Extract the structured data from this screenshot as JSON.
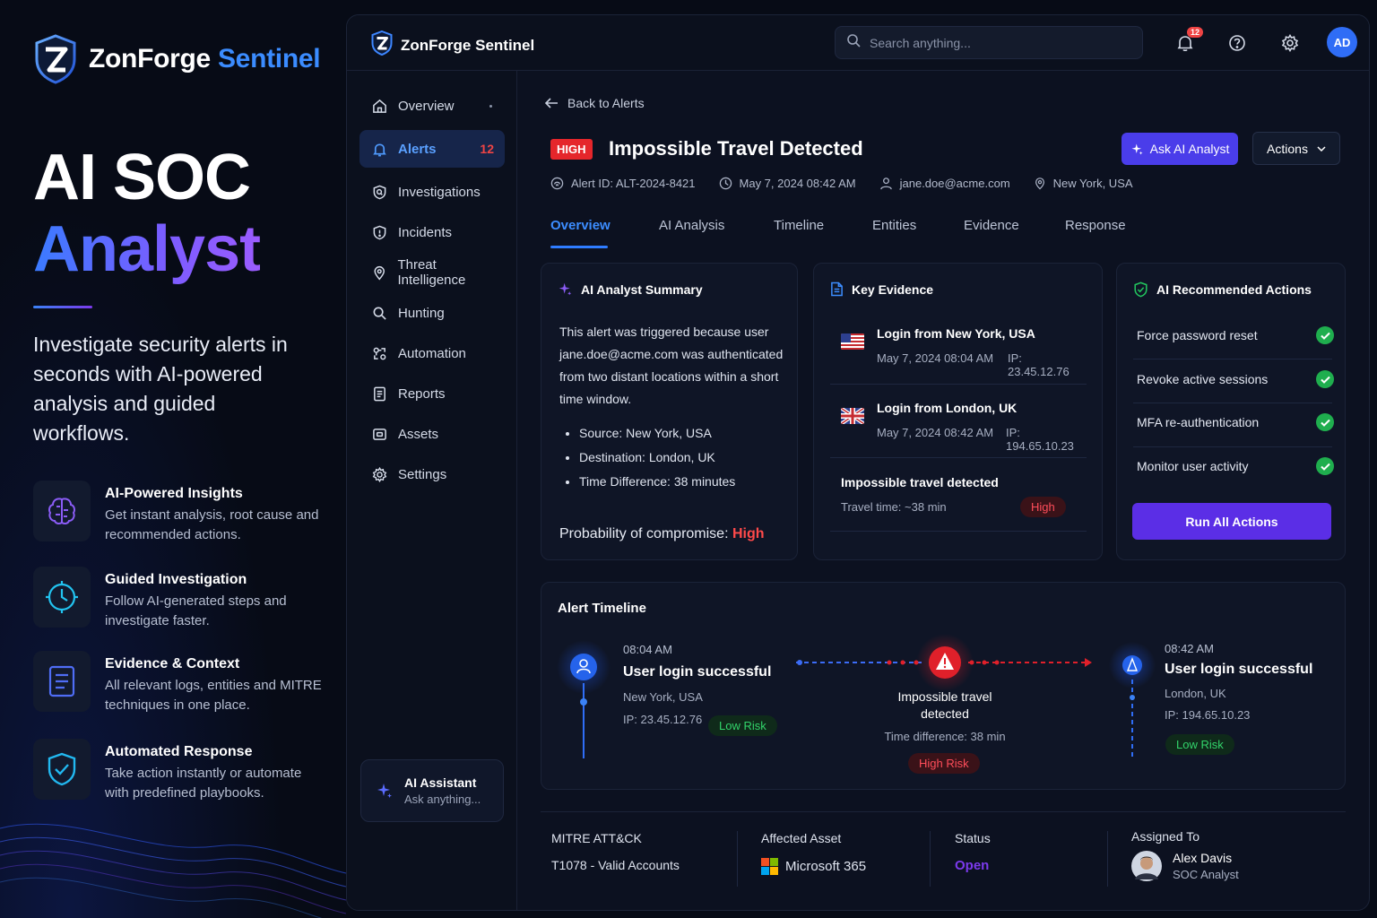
{
  "promo": {
    "brand_word1": "ZonForge",
    "brand_word2": "Sentinel",
    "headline_line1": "AI SOC",
    "headline_line2": "Analyst",
    "tagline": "Investigate security alerts in seconds with AI-powered analysis and guided workflows.",
    "features": [
      {
        "title": "AI-Powered Insights",
        "desc": "Get instant analysis, root cause and recommended actions.",
        "icon": "brain-icon"
      },
      {
        "title": "Guided Investigation",
        "desc": "Follow AI-generated steps and investigate faster.",
        "icon": "clock-icon"
      },
      {
        "title": "Evidence & Context",
        "desc": "All relevant logs, entities and MITRE techniques in one place.",
        "icon": "document-icon"
      },
      {
        "title": "Automated Response",
        "desc": "Take action instantly or automate with predefined playbooks.",
        "icon": "shield-check-icon"
      }
    ]
  },
  "topbar": {
    "brand": "ZonForge Sentinel",
    "search_placeholder": "Search anything...",
    "notification_count": "12",
    "avatar_initials": "AD"
  },
  "sidebar": {
    "items": [
      {
        "label": "Overview",
        "icon": "home-icon"
      },
      {
        "label": "Alerts",
        "icon": "alert-bell-icon",
        "count": "12"
      },
      {
        "label": "Investigations",
        "icon": "search-shield-icon"
      },
      {
        "label": "Incidents",
        "icon": "shield-icon"
      },
      {
        "label": "Threat Intelligence",
        "icon": "pin-icon"
      },
      {
        "label": "Hunting",
        "icon": "search-icon"
      },
      {
        "label": "Automation",
        "icon": "automation-icon"
      },
      {
        "label": "Reports",
        "icon": "report-icon"
      },
      {
        "label": "Assets",
        "icon": "assets-icon"
      },
      {
        "label": "Settings",
        "icon": "gear-icon"
      }
    ],
    "assistant_title": "AI Assistant",
    "assistant_sub": "Ask anything..."
  },
  "alert": {
    "back_label": "Back to Alerts",
    "severity": "HIGH",
    "title": "Impossible Travel Detected",
    "ask_button": "Ask AI Analyst",
    "actions_button": "Actions",
    "meta": {
      "alert_id": "Alert ID: ALT-2024-8421",
      "date": "May 7, 2024 08:42 AM",
      "user": "jane.doe@acme.com",
      "location": "New York, USA"
    },
    "tabs": [
      "Overview",
      "AI Analysis",
      "Timeline",
      "Entities",
      "Evidence",
      "Response"
    ]
  },
  "summary": {
    "title": "AI Analyst Summary",
    "text": "This alert was triggered because user jane.doe@acme.com was authenticated from two distant locations within a short time window.",
    "bullets": [
      "Source: New York, USA",
      "Destination: London, UK",
      "Time Difference: 38 minutes"
    ],
    "prob_label": "Probability of compromise:",
    "prob_value": "High"
  },
  "evidence": {
    "title": "Key Evidence",
    "items": [
      {
        "title": "Login from New York, USA",
        "date": "May 7, 2024 08:04 AM",
        "ip": "IP: 23.45.12.76"
      },
      {
        "title": "Login from London, UK",
        "date": "May 7, 2024 08:42 AM",
        "ip": "IP: 194.65.10.23"
      }
    ],
    "detection_title": "Impossible travel detected",
    "detection_sub": "Travel time: ~38 min",
    "detection_badge": "High"
  },
  "recommended": {
    "title": "AI Recommended Actions",
    "items": [
      "Force password reset",
      "Revoke active sessions",
      "MFA re-authentication",
      "Monitor user activity"
    ],
    "run_button": "Run All Actions"
  },
  "timeline": {
    "title": "Alert Timeline",
    "left": {
      "time": "08:04 AM",
      "title": "User login successful",
      "location": "New York, USA",
      "ip": "IP: 23.45.12.76",
      "risk": "Low Risk"
    },
    "center": {
      "title": "Impossible travel detected",
      "sub": "Time difference: 38 min",
      "risk": "High Risk"
    },
    "right": {
      "time": "08:42 AM",
      "title": "User login successful",
      "location": "London, UK",
      "ip": "IP: 194.65.10.23",
      "risk": "Low Risk"
    }
  },
  "footer": {
    "mitre_label": "MITRE ATT&CK",
    "mitre_value": "T1078 - Valid Accounts",
    "asset_label": "Affected Asset",
    "asset_value": "Microsoft 365",
    "status_label": "Status",
    "status_value": "Open",
    "assigned_label": "Assigned To",
    "assigned_name": "Alex Davis",
    "assigned_role": "SOC Analyst"
  },
  "colors": {
    "accent_blue": "#3c8dff",
    "accent_purple": "#5b2ee6",
    "danger": "#ef4444",
    "success": "#1fae4e"
  }
}
